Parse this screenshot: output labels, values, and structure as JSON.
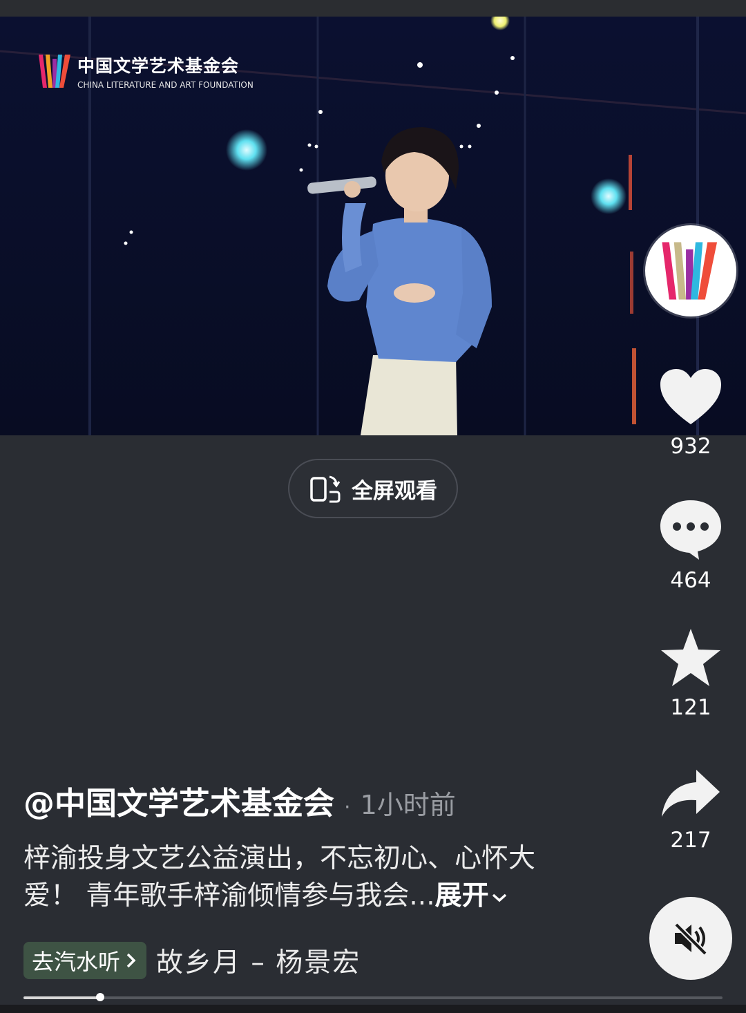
{
  "video": {
    "watermark": {
      "title": "中国文学艺术基金会",
      "subtitle": "CHINA LITERATURE AND ART FOUNDATION"
    }
  },
  "fullscreen": {
    "label": "全屏观看",
    "icon": "rotate-phone-icon"
  },
  "sidebar": {
    "avatar_icon": "foundation-logo",
    "like": {
      "count": "932",
      "icon": "heart-icon"
    },
    "comment": {
      "count": "464",
      "icon": "comment-icon"
    },
    "favorite": {
      "count": "121",
      "icon": "star-icon"
    },
    "share": {
      "count": "217",
      "icon": "share-arrow-icon"
    },
    "mute_icon": "speaker-muted-icon"
  },
  "post": {
    "author": "@中国文学艺术基金会",
    "separator": "·",
    "time": "1小时前",
    "description": "梓渝投身文艺公益演出，不忘初心、心怀大爱！ 青年歌手梓渝倾情参与我会...",
    "expand": "展开"
  },
  "music": {
    "tag": "去汽水听",
    "song": "故乡月 – 杨景宏"
  },
  "progress": {
    "fraction": 0.11
  },
  "colors": {
    "background": "#2a2d33",
    "music_tag": "#3e5344",
    "muted_text": "#9a9da3"
  }
}
